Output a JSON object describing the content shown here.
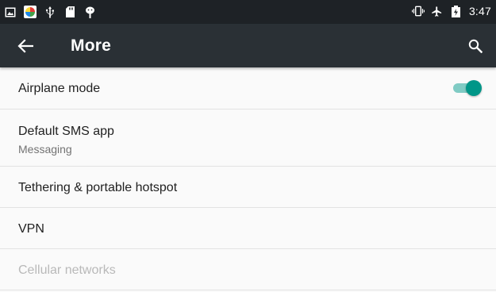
{
  "status_bar": {
    "left_icons": [
      "image-notification-icon",
      "photos-app-icon",
      "usb-icon",
      "sd-card-icon",
      "android-debug-icon"
    ],
    "right_icons": [
      "vibrate-icon",
      "airplane-icon",
      "battery-icon"
    ],
    "time": "3:47"
  },
  "toolbar": {
    "title": "More",
    "back_icon": "arrow-back-icon",
    "search_icon": "search-icon"
  },
  "settings": [
    {
      "title": "Airplane mode",
      "toggle_on": true
    },
    {
      "title": "Default SMS app",
      "summary": "Messaging"
    },
    {
      "title": "Tethering & portable hotspot"
    },
    {
      "title": "VPN"
    },
    {
      "title": "Cellular networks",
      "enabled": false
    }
  ],
  "colors": {
    "status_bar": "#1e2226",
    "toolbar": "#2a3035",
    "accent": "#009688",
    "accent_track": "#80cbc4",
    "background": "#fafafa"
  }
}
